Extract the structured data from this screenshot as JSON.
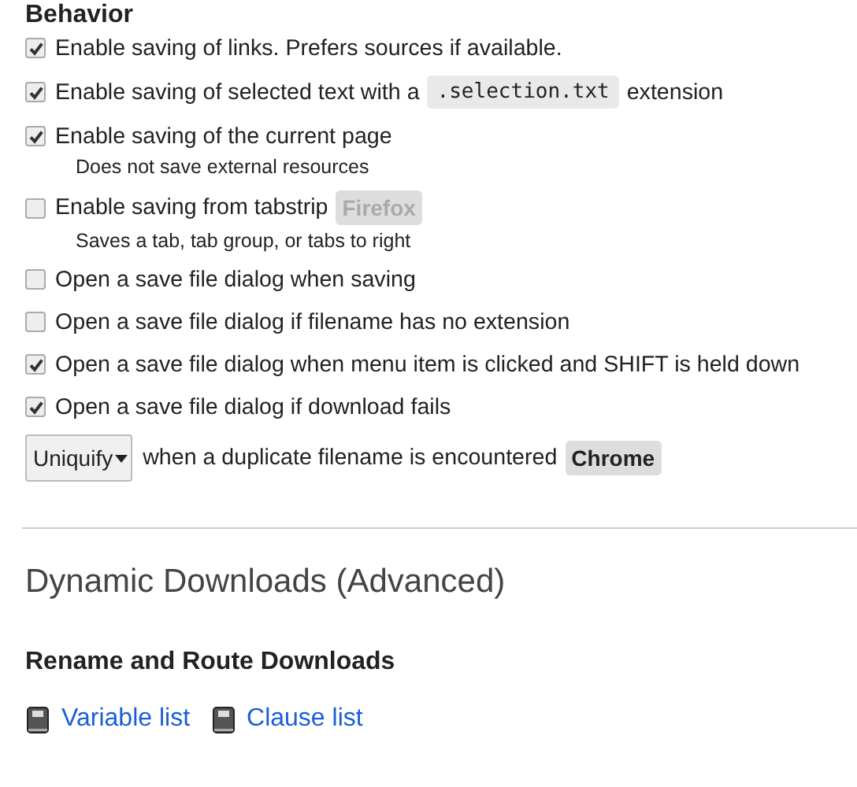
{
  "section_title": "Behavior",
  "options": [
    {
      "checked": true,
      "label": "Enable saving of links. Prefers sources if available."
    },
    {
      "checked": true,
      "label": "Enable saving of selected text with a",
      "code": ".selection.txt",
      "label_after": "extension"
    },
    {
      "checked": true,
      "label": "Enable saving of the current page",
      "note": "Does not save external resources"
    },
    {
      "checked": false,
      "label": "Enable saving from tabstrip",
      "badge": {
        "text": "Firefox",
        "disabled": true
      },
      "note": "Saves a tab, tab group, or tabs to right"
    },
    {
      "checked": false,
      "label": "Open a save file dialog when saving"
    },
    {
      "checked": false,
      "label": "Open a save file dialog if filename has no extension"
    },
    {
      "checked": true,
      "label": "Open a save file dialog when menu item is clicked and SHIFT is held down"
    },
    {
      "checked": true,
      "label": "Open a save file dialog if download fails"
    }
  ],
  "conflict": {
    "dropdown": "Uniquify",
    "label": "when a duplicate filename is encountered",
    "badge": {
      "text": "Chrome",
      "disabled": false
    }
  },
  "advanced_title": "Dynamic Downloads (Advanced)",
  "rename_title": "Rename and Route Downloads",
  "links": [
    "Variable list",
    "Clause list"
  ]
}
